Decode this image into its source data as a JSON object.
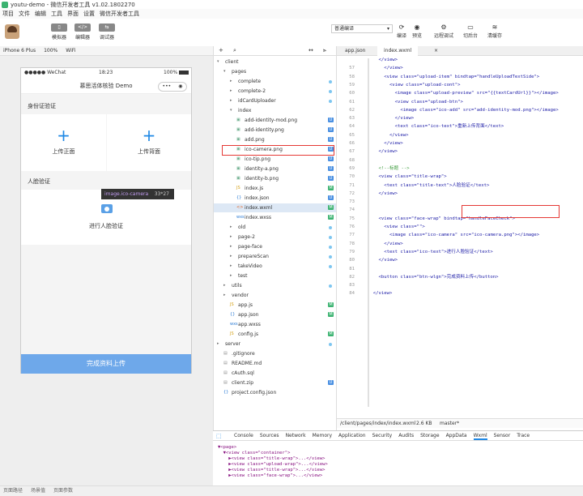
{
  "window": {
    "title": "youtu-demo - 微信开发者工具 v1.02.1802270"
  },
  "menu": [
    "项目",
    "文件",
    "编辑",
    "工具",
    "界面",
    "设置",
    "微信开发者工具"
  ],
  "toolbar": {
    "simulator": "模拟器",
    "editor": "编辑器",
    "debugger": "调试器"
  },
  "mode_select": "普通编译",
  "right_tools": {
    "compile": "编译",
    "preview": "预览",
    "remote_debug": "远程调试",
    "background": "切后台",
    "clear_cache": "清缓存"
  },
  "device": {
    "model": "iPhone 6 Plus",
    "zoom": "100%",
    "network": "WiFi"
  },
  "phone": {
    "carrier": "●●●●● WeChat",
    "time": "18:23",
    "battery": "100%",
    "nav_title": "慕思活体核验 Demo",
    "id_section": "身份证验证",
    "upload_front": "上传正面",
    "upload_back": "上传背面",
    "face_section": "人脸验证",
    "face_label": "进行人脸验证",
    "tooltip_name": "image.ico-camera",
    "tooltip_size": "33*27",
    "submit": "完成资料上传"
  },
  "tree": [
    {
      "name": "client",
      "indent": 0,
      "type": "folder-open"
    },
    {
      "name": "pages",
      "indent": 1,
      "type": "folder-open"
    },
    {
      "name": "complete",
      "indent": 2,
      "type": "folder",
      "mark": "dot"
    },
    {
      "name": "complete-2",
      "indent": 2,
      "type": "folder",
      "mark": "dot"
    },
    {
      "name": "idCardUploader",
      "indent": 2,
      "type": "folder",
      "mark": "dot"
    },
    {
      "name": "index",
      "indent": 2,
      "type": "folder-open"
    },
    {
      "name": "add-identity-mod.png",
      "indent": 3,
      "type": "img",
      "mark": "U"
    },
    {
      "name": "add-identity.png",
      "indent": 3,
      "type": "img",
      "mark": "U"
    },
    {
      "name": "add.png",
      "indent": 3,
      "type": "img",
      "mark": "U"
    },
    {
      "name": "ico-camera.png",
      "indent": 3,
      "type": "img",
      "mark": "U"
    },
    {
      "name": "ico-tip.png",
      "indent": 3,
      "type": "img",
      "mark": "U"
    },
    {
      "name": "identity-a.png",
      "indent": 3,
      "type": "img",
      "mark": "U"
    },
    {
      "name": "identity-b.png",
      "indent": 3,
      "type": "img",
      "mark": "U"
    },
    {
      "name": "index.js",
      "indent": 3,
      "type": "js",
      "mark": "M"
    },
    {
      "name": "index.json",
      "indent": 3,
      "type": "json",
      "mark": "U"
    },
    {
      "name": "index.wxml",
      "indent": 3,
      "type": "wxml",
      "mark": "M"
    },
    {
      "name": "index.wxss",
      "indent": 3,
      "type": "wxss",
      "mark": "M"
    },
    {
      "name": "old",
      "indent": 2,
      "type": "folder",
      "mark": "dot"
    },
    {
      "name": "page-2",
      "indent": 2,
      "type": "folder",
      "mark": "dot"
    },
    {
      "name": "page-face",
      "indent": 2,
      "type": "folder",
      "mark": "dot"
    },
    {
      "name": "prepareScan",
      "indent": 2,
      "type": "folder",
      "mark": "dot"
    },
    {
      "name": "takeVideo",
      "indent": 2,
      "type": "folder",
      "mark": "dot"
    },
    {
      "name": "test",
      "indent": 2,
      "type": "folder"
    },
    {
      "name": "utils",
      "indent": 1,
      "type": "folder",
      "mark": "dot"
    },
    {
      "name": "vendor",
      "indent": 1,
      "type": "folder"
    },
    {
      "name": "app.js",
      "indent": 2,
      "type": "js",
      "mark": "M"
    },
    {
      "name": "app.json",
      "indent": 2,
      "type": "json",
      "mark": "M"
    },
    {
      "name": "app.wxss",
      "indent": 2,
      "type": "wxss"
    },
    {
      "name": "config.js",
      "indent": 2,
      "type": "js",
      "mark": "M"
    },
    {
      "name": "server",
      "indent": 0,
      "type": "folder",
      "mark": "dot"
    },
    {
      "name": ".gitignore",
      "indent": 1,
      "type": "file"
    },
    {
      "name": "README.md",
      "indent": 1,
      "type": "file"
    },
    {
      "name": "cAuth.sql",
      "indent": 1,
      "type": "file"
    },
    {
      "name": "client.zip",
      "indent": 1,
      "type": "file",
      "mark": "U"
    },
    {
      "name": "project.config.json",
      "indent": 1,
      "type": "json"
    }
  ],
  "editor_tabs": [
    "app.json",
    "index.wxml"
  ],
  "code": [
    {
      "n": "",
      "t": "    </view>"
    },
    {
      "n": "57",
      "t": "      </view>"
    },
    {
      "n": "58",
      "t": "      <view class=\"upload-item\" bindtap=\"handleUploadTextSide\">"
    },
    {
      "n": "59",
      "t": "        <view class=\"upload-cont\">"
    },
    {
      "n": "60",
      "t": "          <image class=\"upload-preview\" src=\"{{textCardUrl}}\"></image>"
    },
    {
      "n": "61",
      "t": "          <view class=\"upload-btn\">"
    },
    {
      "n": "62",
      "t": "            <image class=\"ico-add\" src=\"add-identity-mod.png\"></image>"
    },
    {
      "n": "63",
      "t": "          </view>"
    },
    {
      "n": "64",
      "t": "          <text class=\"ico-text\">重新上传背面</text>"
    },
    {
      "n": "65",
      "t": "        </view>"
    },
    {
      "n": "66",
      "t": "      </view>"
    },
    {
      "n": "67",
      "t": "    </view>"
    },
    {
      "n": "68",
      "t": ""
    },
    {
      "n": "69",
      "t": "    <!--标题 -->"
    },
    {
      "n": "70",
      "t": "    <view class=\"title-wrap\">"
    },
    {
      "n": "71",
      "t": "      <text class=\"title-text\">人脸验证</text>"
    },
    {
      "n": "72",
      "t": "    </view>"
    },
    {
      "n": "73",
      "t": ""
    },
    {
      "n": "74",
      "t": ""
    },
    {
      "n": "75",
      "t": "    <view class=\"face-wrap\" bindtap=\"handleFaceCheck\">"
    },
    {
      "n": "76",
      "t": "      <view class=\"\">"
    },
    {
      "n": "77",
      "t": "        <image class=\"ico-camera\" src=\"ico-camera.png\"></image>"
    },
    {
      "n": "78",
      "t": "      </view>"
    },
    {
      "n": "79",
      "t": "      <text class=\"ico-text\">进行人脸验证</text>"
    },
    {
      "n": "80",
      "t": "    </view>"
    },
    {
      "n": "81",
      "t": ""
    },
    {
      "n": "82",
      "t": "    <button class=\"btn-wlgn\">完成资料上传</button>"
    },
    {
      "n": "83",
      "t": ""
    },
    {
      "n": "84",
      "t": "  </view>"
    }
  ],
  "editor_status": {
    "path": "/client/pages/index/index.wxml",
    "size": "2.6 KB",
    "branch": "master*"
  },
  "devtools_tabs": [
    "Console",
    "Sources",
    "Network",
    "Memory",
    "Application",
    "Security",
    "Audits",
    "Storage",
    "AppData",
    "Wxml",
    "Sensor",
    "Trace"
  ],
  "xml": [
    "▼<page>",
    "  ▼<view class=\"container\">",
    "    ▶<view class=\"title-wrap\">...</view>",
    "    ▶<view class=\"upload-wrap\">...</view>",
    "    ▶<view class=\"title-wrap\">...</view>",
    "    ▶<view class=\"face-wrap\">...</view>"
  ],
  "bottom": [
    "页面路径",
    "场景值",
    "页面参数"
  ],
  "colors": {
    "accent": "#1e88e5",
    "submit": "#6ea8ea",
    "highlight": "#e53935"
  }
}
